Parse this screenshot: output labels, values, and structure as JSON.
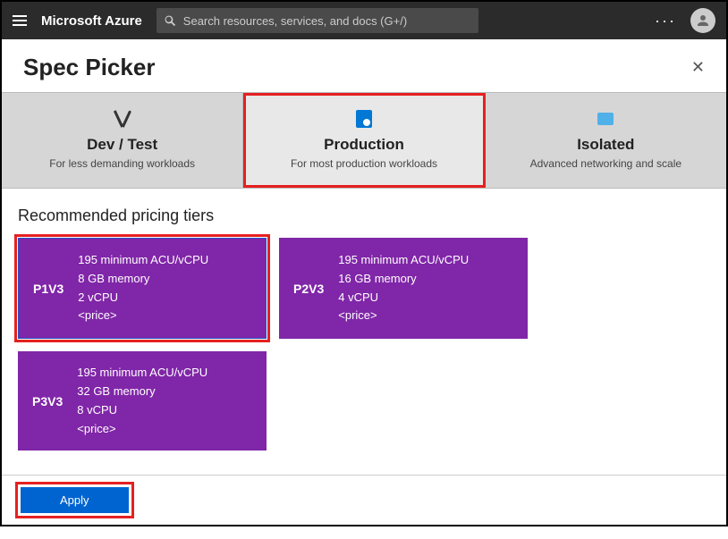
{
  "topbar": {
    "brand": "Microsoft Azure",
    "search_placeholder": "Search resources, services, and docs (G+/)"
  },
  "blade": {
    "title": "Spec Picker"
  },
  "tabs": [
    {
      "title": "Dev / Test",
      "subtitle": "For less demanding workloads"
    },
    {
      "title": "Production",
      "subtitle": "For most production workloads"
    },
    {
      "title": "Isolated",
      "subtitle": "Advanced networking and scale"
    }
  ],
  "section": {
    "title": "Recommended pricing tiers"
  },
  "cards": [
    {
      "name": "P1V3",
      "acu": "195 minimum ACU/vCPU",
      "memory": "8 GB memory",
      "vcpu": "2 vCPU",
      "price": "<price>"
    },
    {
      "name": "P2V3",
      "acu": "195 minimum ACU/vCPU",
      "memory": "16 GB memory",
      "vcpu": "4 vCPU",
      "price": "<price>"
    },
    {
      "name": "P3V3",
      "acu": "195 minimum ACU/vCPU",
      "memory": "32 GB memory",
      "vcpu": "8 vCPU",
      "price": "<price>"
    }
  ],
  "footer": {
    "apply": "Apply"
  }
}
